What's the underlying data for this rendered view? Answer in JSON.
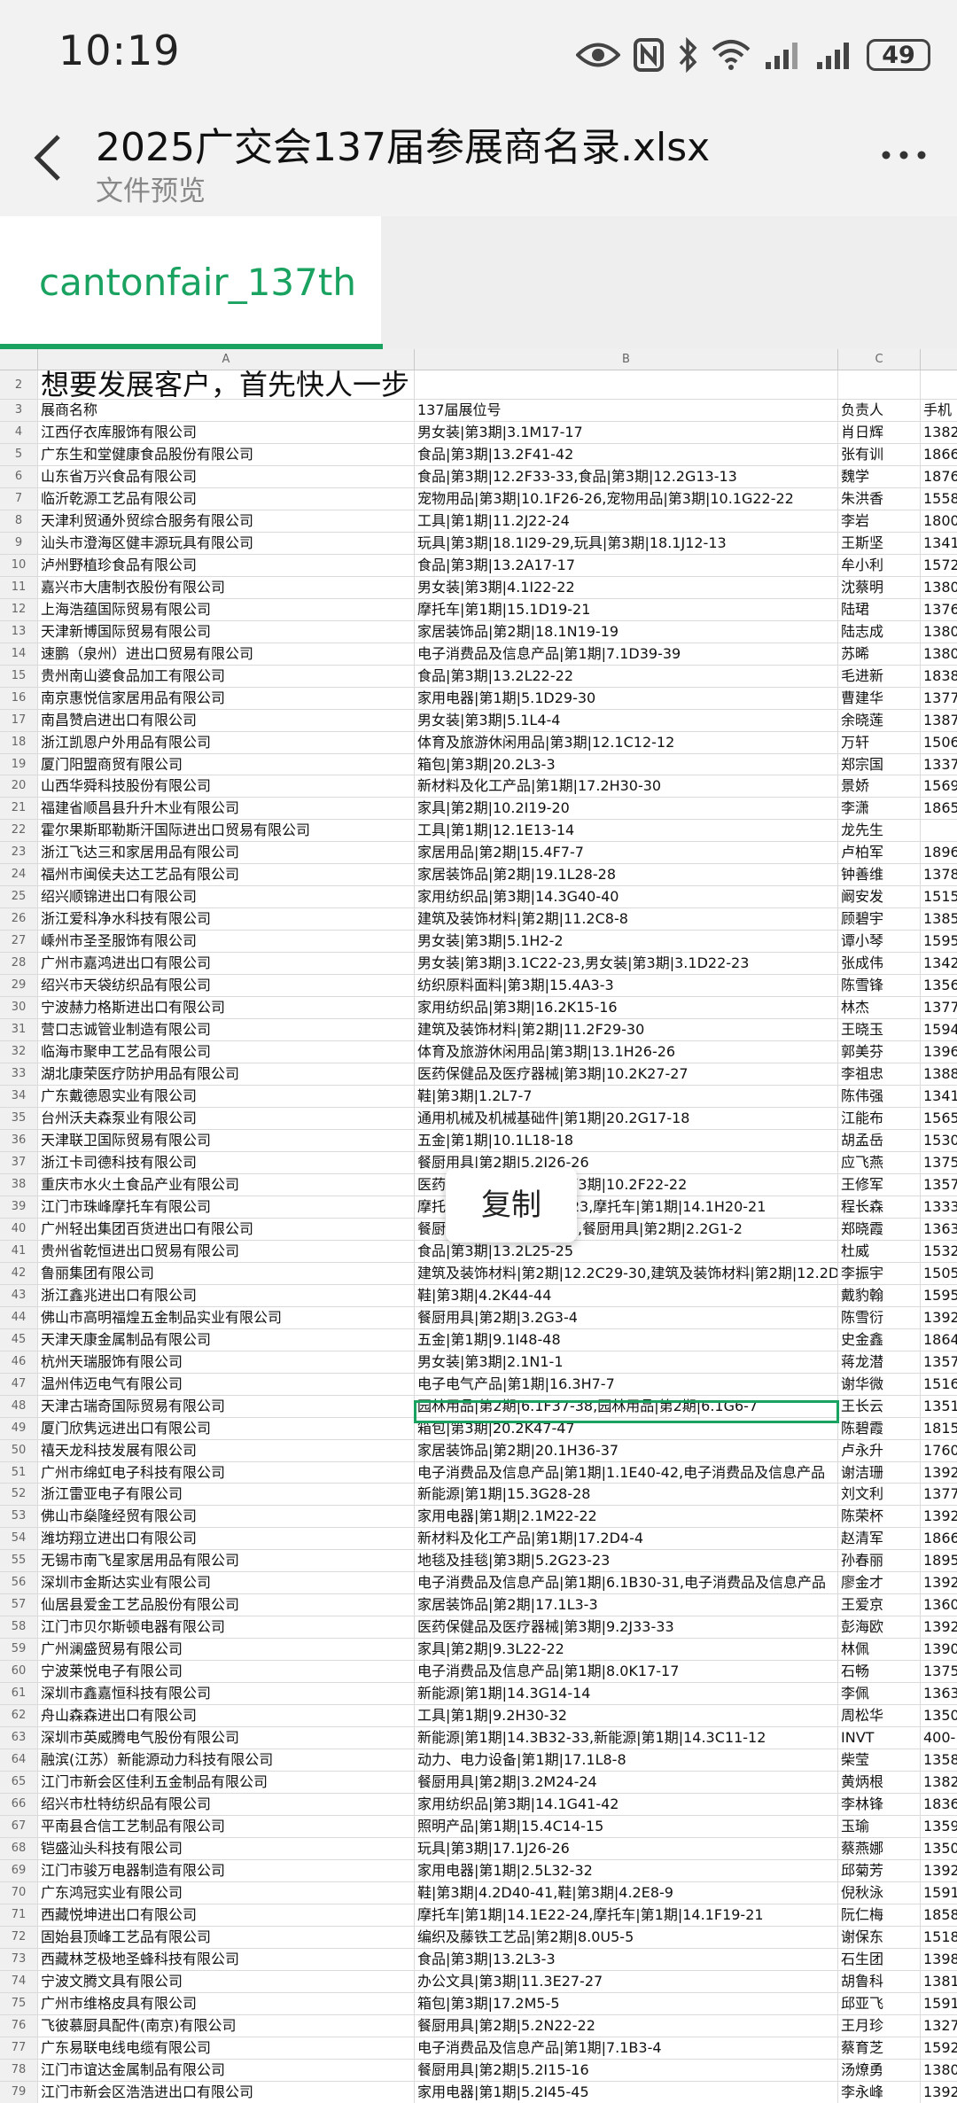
{
  "status": {
    "time": "10:19",
    "battery": "49"
  },
  "header": {
    "title": "2025广交会137届参展商名录.xlsx",
    "subtitle": "文件预览"
  },
  "sheet_tab": {
    "label": "cantonfair_137th"
  },
  "columns": [
    "A",
    "B",
    "C"
  ],
  "popup": {
    "copy_label": "复制"
  },
  "rows": [
    {
      "n": "2",
      "a": "想要发展客户，首先快人一步",
      "b": "",
      "c": "",
      "d": ""
    },
    {
      "n": "3",
      "a": "展商名称",
      "b": "137届展位号",
      "c": "负责人",
      "d": "手机"
    },
    {
      "n": "4",
      "a": "江西仔衣库服饰有限公司",
      "b": "男女装|第3期|3.1M17-17",
      "c": "肖日辉",
      "d": "1382"
    },
    {
      "n": "5",
      "a": "广东生和堂健康食品股份有限公司",
      "b": "食品|第3期|13.2F41-42",
      "c": "张有训",
      "d": "1866"
    },
    {
      "n": "6",
      "a": "山东省万兴食品有限公司",
      "b": "食品|第3期|12.2F33-33,食品|第3期|12.2G13-13",
      "c": "魏学",
      "d": "1876"
    },
    {
      "n": "7",
      "a": "临沂乾源工艺品有限公司",
      "b": "宠物用品|第3期|10.1F26-26,宠物用品|第3期|10.1G22-22",
      "c": "朱洪香",
      "d": "1558"
    },
    {
      "n": "8",
      "a": "天津利贸通外贸综合服务有限公司",
      "b": "工具|第1期|11.2J22-24",
      "c": "李岩",
      "d": "1800"
    },
    {
      "n": "9",
      "a": "汕头市澄海区健丰源玩具有限公司",
      "b": "玩具|第3期|18.1I29-29,玩具|第3期|18.1J12-13",
      "c": "王斯坚",
      "d": "1341"
    },
    {
      "n": "10",
      "a": "泸州野植珍食品有限公司",
      "b": "食品|第3期|13.2A17-17",
      "c": "牟小利",
      "d": "1572"
    },
    {
      "n": "11",
      "a": "嘉兴市大唐制衣股份有限公司",
      "b": "男女装|第3期|4.1I22-22",
      "c": "沈蔡明",
      "d": "1380"
    },
    {
      "n": "12",
      "a": "上海浩蕴国际贸易有限公司",
      "b": "摩托车|第1期|15.1D19-21",
      "c": "陆珺",
      "d": "1376"
    },
    {
      "n": "13",
      "a": "天津新博国际贸易有限公司",
      "b": "家居装饰品|第2期|18.1N19-19",
      "c": "陆志成",
      "d": "1380"
    },
    {
      "n": "14",
      "a": "速鹏（泉州）进出口贸易有限公司",
      "b": "电子消费品及信息产品|第1期|7.1D39-39",
      "c": "苏晞",
      "d": "1380"
    },
    {
      "n": "15",
      "a": "贵州南山婆食品加工有限公司",
      "b": "食品|第3期|13.2L22-22",
      "c": "毛进新",
      "d": "1838"
    },
    {
      "n": "16",
      "a": "南京惠悦信家居用品有限公司",
      "b": "家用电器|第1期|5.1D29-30",
      "c": "曹建华",
      "d": "1377"
    },
    {
      "n": "17",
      "a": "南昌赞启进出口有限公司",
      "b": "男女装|第3期|5.1L4-4",
      "c": "余晓莲",
      "d": "1387"
    },
    {
      "n": "18",
      "a": "浙江凯恩户外用品有限公司",
      "b": "体育及旅游休闲用品|第3期|12.1C12-12",
      "c": "万轩",
      "d": "1506"
    },
    {
      "n": "19",
      "a": "厦门阳盟商贸有限公司",
      "b": "箱包|第3期|20.2L3-3",
      "c": "郑宗国",
      "d": "1337"
    },
    {
      "n": "20",
      "a": "山西华舜科技股份有限公司",
      "b": "新材料及化工产品|第1期|17.2H30-30",
      "c": "景娇",
      "d": "1569"
    },
    {
      "n": "21",
      "a": "福建省顺昌县升升木业有限公司",
      "b": "家具|第2期|10.2I19-20",
      "c": "李潇",
      "d": "1865"
    },
    {
      "n": "22",
      "a": "霍尔果斯耶勒斯汗国际进出口贸易有限公司",
      "b": "工具|第1期|12.1E13-14",
      "c": "龙先生",
      "d": ""
    },
    {
      "n": "23",
      "a": "浙江飞达三和家居用品有限公司",
      "b": "家居用品|第2期|15.4F7-7",
      "c": "卢柏军",
      "d": "1896"
    },
    {
      "n": "24",
      "a": "福州市闽侯夫达工艺品有限公司",
      "b": "家居装饰品|第2期|19.1L28-28",
      "c": "钟善维",
      "d": "1378"
    },
    {
      "n": "25",
      "a": "绍兴顺锦进出口有限公司",
      "b": "家用纺织品|第3期|14.3G40-40",
      "c": "阚安发",
      "d": "1515"
    },
    {
      "n": "26",
      "a": "浙江爱科净水科技有限公司",
      "b": "建筑及装饰材料|第2期|11.2C8-8",
      "c": "顾碧宇",
      "d": "1385"
    },
    {
      "n": "27",
      "a": "嵊州市圣圣服饰有限公司",
      "b": "男女装|第3期|5.1H2-2",
      "c": "谭小琴",
      "d": "1595"
    },
    {
      "n": "28",
      "a": "广州市嘉鸿进出口有限公司",
      "b": "男女装|第3期|3.1C22-23,男女装|第3期|3.1D22-23",
      "c": "张成伟",
      "d": "1342"
    },
    {
      "n": "29",
      "a": "绍兴市天袋纺织品有限公司",
      "b": "纺织原料面料|第3期|15.4A3-3",
      "c": "陈雪锋",
      "d": "1356"
    },
    {
      "n": "30",
      "a": "宁波赫力格斯进出口有限公司",
      "b": "家用纺织品|第3期|16.2K15-16",
      "c": "林杰",
      "d": "1377"
    },
    {
      "n": "31",
      "a": "营口志诚管业制造有限公司",
      "b": "建筑及装饰材料|第2期|11.2F29-30",
      "c": "王晓玉",
      "d": "1594"
    },
    {
      "n": "32",
      "a": "临海市聚申工艺品有限公司",
      "b": "体育及旅游休闲用品|第3期|13.1H26-26",
      "c": "郭美芬",
      "d": "1396"
    },
    {
      "n": "33",
      "a": "湖北康荣医疗防护用品有限公司",
      "b": "医药保健品及医疗器械|第3期|10.2K27-27",
      "c": "李祖忠",
      "d": "1388"
    },
    {
      "n": "34",
      "a": "广东戴德恩实业有限公司",
      "b": "鞋|第3期|1.2L7-7",
      "c": "陈伟强",
      "d": "1341"
    },
    {
      "n": "35",
      "a": "台州沃夫森泵业有限公司",
      "b": "通用机械及机械基础件|第1期|20.2G17-18",
      "c": "江能布",
      "d": "1565"
    },
    {
      "n": "36",
      "a": "天津联卫国际贸易有限公司",
      "b": "五金|第1期|10.1L18-18",
      "c": "胡孟岳",
      "d": "1530"
    },
    {
      "n": "37",
      "a": "浙江卡司德科技有限公司",
      "b": "餐厨用具|第2期|5.2I26-26",
      "c": "应飞燕",
      "d": "1375"
    },
    {
      "n": "38",
      "a": "重庆市水火土食品产业有限公司",
      "b": "医药保健品及医疗器械|第3期|10.2F22-22",
      "c": "王修军",
      "d": "1357"
    },
    {
      "n": "39",
      "a": "江门市珠峰摩托车有限公司",
      "b": "摩托车|第1期|14.1E19-23,摩托车|第1期|14.1H20-21",
      "c": "程长森",
      "d": "1333"
    },
    {
      "n": "40",
      "a": "广州轻出集团百货进出口有限公司",
      "b": "餐厨用具|第2期|2.2G1-4,餐厨用具|第2期|2.2G1-2",
      "c": "郑晓霞",
      "d": "1363"
    },
    {
      "n": "41",
      "a": "贵州省乾恒进出口贸易有限公司",
      "b": "食品|第3期|13.2L25-25",
      "c": "杜威",
      "d": "1532"
    },
    {
      "n": "42",
      "a": "鲁丽集团有限公司",
      "b": "建筑及装饰材料|第2期|12.2C29-30,建筑及装饰材料|第2期|12.2D",
      "c": "李振宇",
      "d": "1505"
    },
    {
      "n": "43",
      "a": "浙江鑫兆进出口有限公司",
      "b": "鞋|第3期|4.2K44-44",
      "c": "戴豹翰",
      "d": "1595"
    },
    {
      "n": "44",
      "a": "佛山市高明福煌五金制品实业有限公司",
      "b": "餐厨用具|第2期|3.2G3-4",
      "c": "陈雪衍",
      "d": "1392"
    },
    {
      "n": "45",
      "a": "天津天康金属制品有限公司",
      "b": "五金|第1期|9.1I48-48",
      "c": "史金鑫",
      "d": "1864"
    },
    {
      "n": "46",
      "a": "杭州天瑞服饰有限公司",
      "b": "男女装|第3期|2.1N1-1",
      "c": "蒋龙潜",
      "d": "1357"
    },
    {
      "n": "47",
      "a": "温州伟迈电气有限公司",
      "b": "电子电气产品|第1期|16.3H7-7",
      "c": "谢华微",
      "d": "1516"
    },
    {
      "n": "48",
      "a": "天津古瑞奇国际贸易有限公司",
      "b": "园林用品|第2期|6.1F37-38,园林用品|第2期|6.1G6-7",
      "c": "王长云",
      "d": "1351"
    },
    {
      "n": "49",
      "a": "厦门欣隽远进出口有限公司",
      "b": "箱包|第3期|20.2K47-47",
      "c": "陈碧霞",
      "d": "1815"
    },
    {
      "n": "50",
      "a": "禧天龙科技发展有限公司",
      "b": "家居装饰品|第2期|20.1H36-37",
      "c": "卢永升",
      "d": "1760"
    },
    {
      "n": "51",
      "a": "广州市绵虹电子科技有限公司",
      "b": "电子消费品及信息产品|第1期|1.1E40-42,电子消费品及信息产品",
      "c": "谢洁珊",
      "d": "1392"
    },
    {
      "n": "52",
      "a": "浙江雷亚电子有限公司",
      "b": "新能源|第1期|15.3G28-28",
      "c": "刘文利",
      "d": "1377"
    },
    {
      "n": "53",
      "a": "佛山市燊隆经贸有限公司",
      "b": "家用电器|第1期|2.1M22-22",
      "c": "陈荣杯",
      "d": "1392"
    },
    {
      "n": "54",
      "a": "潍坊翔立进出口有限公司",
      "b": "新材料及化工产品|第1期|17.2D4-4",
      "c": "赵清军",
      "d": "1866"
    },
    {
      "n": "55",
      "a": "无锡市南飞星家居用品有限公司",
      "b": "地毯及挂毯|第3期|5.2G23-23",
      "c": "孙春丽",
      "d": "1895"
    },
    {
      "n": "56",
      "a": "深圳市金斯达实业有限公司",
      "b": "电子消费品及信息产品|第1期|6.1B30-31,电子消费品及信息产品",
      "c": "廖金才",
      "d": "1392"
    },
    {
      "n": "57",
      "a": "仙居县爱金工艺品股份有限公司",
      "b": "家居装饰品|第2期|17.1L3-3",
      "c": "王爱京",
      "d": "1360"
    },
    {
      "n": "58",
      "a": "江门市贝尔斯顿电器有限公司",
      "b": "医药保健品及医疗器械|第3期|9.2J33-33",
      "c": "彭海欧",
      "d": "1392"
    },
    {
      "n": "59",
      "a": "广州澜盛贸易有限公司",
      "b": "家具|第2期|9.3L22-22",
      "c": "林佩",
      "d": "1390"
    },
    {
      "n": "60",
      "a": "宁波莱悦电子有限公司",
      "b": "电子消费品及信息产品|第1期|8.0K17-17",
      "c": "石畅",
      "d": "1375"
    },
    {
      "n": "61",
      "a": "深圳市鑫嘉恒科技有限公司",
      "b": "新能源|第1期|14.3G14-14",
      "c": "李佩",
      "d": "1363"
    },
    {
      "n": "62",
      "a": "舟山森森进出口有限公司",
      "b": "工具|第1期|9.2H30-32",
      "c": "周松华",
      "d": "1350"
    },
    {
      "n": "63",
      "a": "深圳市英威腾电气股份有限公司",
      "b": "新能源|第1期|14.3B32-33,新能源|第1期|14.3C11-12",
      "c": "INVT",
      "d": "400-"
    },
    {
      "n": "64",
      "a": "融滨(江苏）新能源动力科技有限公司",
      "b": "动力、电力设备|第1期|17.1L8-8",
      "c": "柴莹",
      "d": "1358"
    },
    {
      "n": "65",
      "a": "江门市新会区佳利五金制品有限公司",
      "b": "餐厨用具|第2期|3.2M24-24",
      "c": "黄炳根",
      "d": "1382"
    },
    {
      "n": "66",
      "a": "绍兴市杜特纺织品有限公司",
      "b": "家用纺织品|第3期|14.1G41-42",
      "c": "李林锋",
      "d": "1836"
    },
    {
      "n": "67",
      "a": "平南县合信工艺制品有限公司",
      "b": "照明产品|第1期|15.4C14-15",
      "c": "玉瑜",
      "d": "1359"
    },
    {
      "n": "68",
      "a": "铠盛汕头科技有限公司",
      "b": "玩具|第3期|17.1J26-26",
      "c": "蔡燕娜",
      "d": "1350"
    },
    {
      "n": "69",
      "a": "江门市骏万电器制造有限公司",
      "b": "家用电器|第1期|2.5L32-32",
      "c": "邱菊芳",
      "d": "1392"
    },
    {
      "n": "70",
      "a": "广东鸿冠实业有限公司",
      "b": "鞋|第3期|4.2D40-41,鞋|第3期|4.2E8-9",
      "c": "倪秋泳",
      "d": "1591"
    },
    {
      "n": "71",
      "a": "西藏悦坤进出口有限公司",
      "b": "摩托车|第1期|14.1E22-24,摩托车|第1期|14.1F19-21",
      "c": "阮仁梅",
      "d": "1858"
    },
    {
      "n": "72",
      "a": "固始县顶峰工艺品有限公司",
      "b": "编织及藤铁工艺品|第2期|8.0U5-5",
      "c": "谢保东",
      "d": "1518"
    },
    {
      "n": "73",
      "a": "西藏林芝极地圣蜂科技有限公司",
      "b": "食品|第3期|13.2L3-3",
      "c": "石生团",
      "d": "1398"
    },
    {
      "n": "74",
      "a": "宁波文腾文具有限公司",
      "b": "办公文具|第3期|11.3E27-27",
      "c": "胡鲁科",
      "d": "1381"
    },
    {
      "n": "75",
      "a": "广州市维格皮具有限公司",
      "b": "箱包|第3期|17.2M5-5",
      "c": "邱亚飞",
      "d": "1591"
    },
    {
      "n": "76",
      "a": "飞彼慕厨具配件(南京)有限公司",
      "b": "餐厨用具|第2期|5.2N22-22",
      "c": "王月珍",
      "d": "1327"
    },
    {
      "n": "77",
      "a": "广东易联电线电缆有限公司",
      "b": "电子消费品及信息产品|第1期|7.1B3-4",
      "c": "蔡育芝",
      "d": "1592"
    },
    {
      "n": "78",
      "a": "江门市谊达金属制品有限公司",
      "b": "餐厨用具|第2期|5.2I15-16",
      "c": "汤燎勇",
      "d": "1380"
    },
    {
      "n": "79",
      "a": "江门市新会区浩浩进出口有限公司",
      "b": "家用电器|第1期|5.2I45-45",
      "c": "李永峰",
      "d": "1392"
    }
  ]
}
